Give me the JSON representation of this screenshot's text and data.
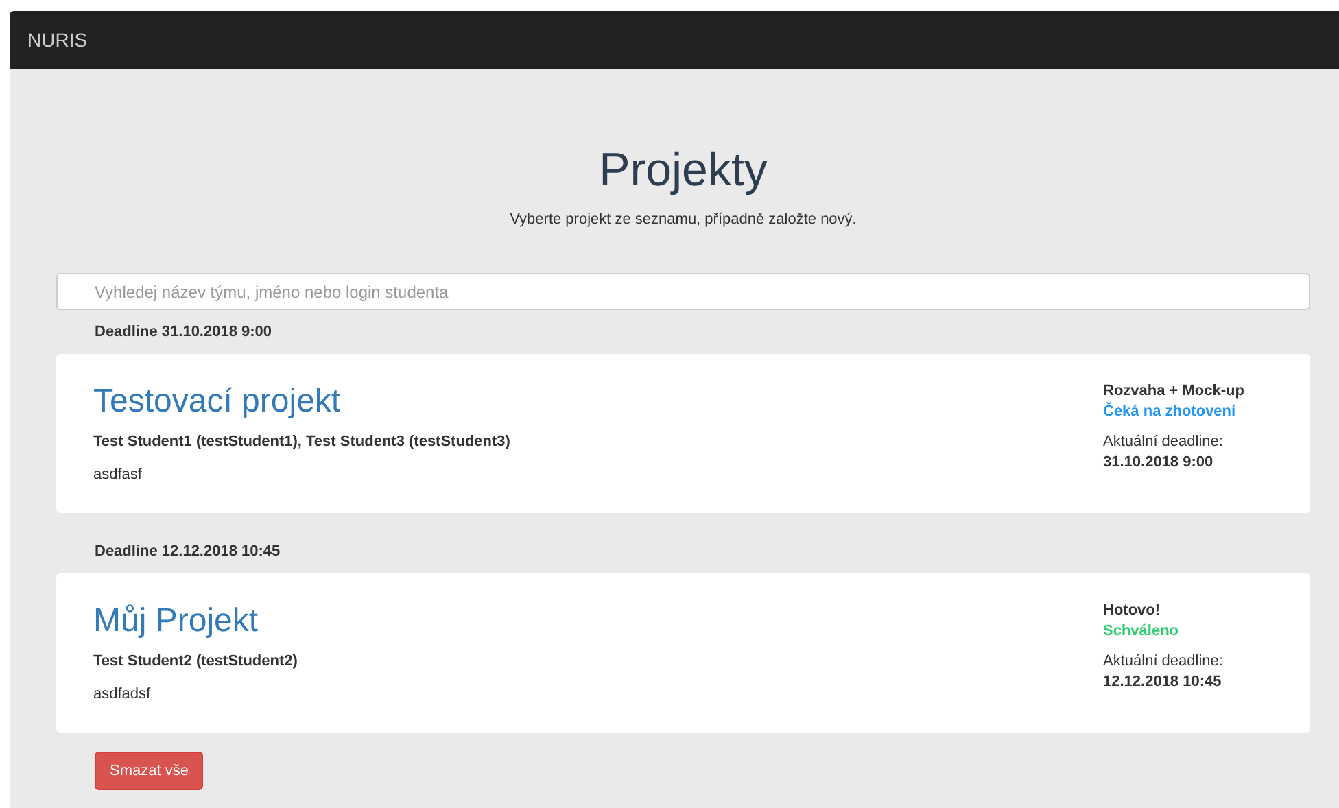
{
  "navbar": {
    "brand": "NURIS"
  },
  "header": {
    "title": "Projekty",
    "subtitle": "Vyberte projekt ze seznamu, případně založte nový."
  },
  "search": {
    "placeholder": "Vyhledej název týmu, jméno nebo login studenta"
  },
  "groups": [
    {
      "deadline": "Deadline 31.10.2018 9:00",
      "projects": [
        {
          "title": "Testovací projekt",
          "members": "Test Student1 (testStudent1), Test Student3 (testStudent3)",
          "description": "asdfasf",
          "phase": "Rozvaha + Mock-up",
          "status": "Čeká na zhotovení",
          "color": "#2196f3",
          "deadline_label": "Aktuální deadline:",
          "deadline": "31.10.2018 9:00"
        }
      ]
    },
    {
      "deadline": "Deadline 12.12.2018 10:45",
      "projects": [
        {
          "title": "Můj Projekt",
          "members": "Test Student2 (testStudent2)",
          "description": "asdfadsf",
          "phase": "Hotovo!",
          "status": "Schváleno",
          "color": "#2ecc71",
          "deadline_label": "Aktuální deadline:",
          "deadline": "12.12.2018 10:45"
        }
      ]
    }
  ],
  "delete_button": "Smazat vše"
}
